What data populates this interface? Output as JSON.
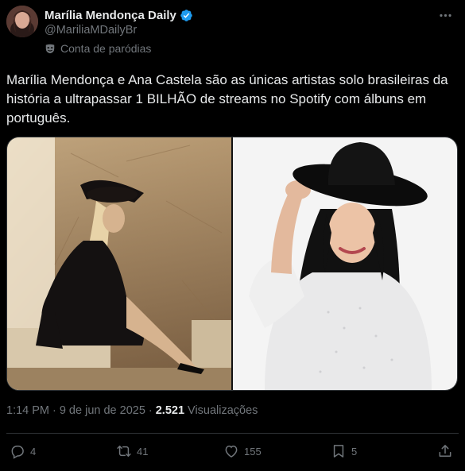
{
  "author": {
    "display_name": "Marília Mendonça Daily",
    "handle": "@MariliaMDailyBr",
    "account_label": "Conta de paródias",
    "verified": true,
    "avatar_icon": "avatar-photo"
  },
  "tweet": {
    "text": "Marília Mendonça e Ana Castela são as únicas artistas solo brasileiras da história a ultrapassar 1 BILHÃO de streams no Spotify com álbuns em português.",
    "media": [
      {
        "description_icon": "photo-left"
      },
      {
        "description_icon": "photo-right"
      }
    ]
  },
  "meta": {
    "time": "1:14 PM",
    "separator": "·",
    "date": "9 de jun de 2025",
    "views_count": "2.521",
    "views_label": "Visualizações"
  },
  "actions": {
    "replies": "4",
    "retweets": "41",
    "likes": "155",
    "bookmarks": "5"
  },
  "colors": {
    "background": "#000000",
    "text_primary": "#e7e9ea",
    "text_secondary": "#71767b",
    "verified_blue": "#1d9bf0",
    "divider": "#2f3336"
  }
}
